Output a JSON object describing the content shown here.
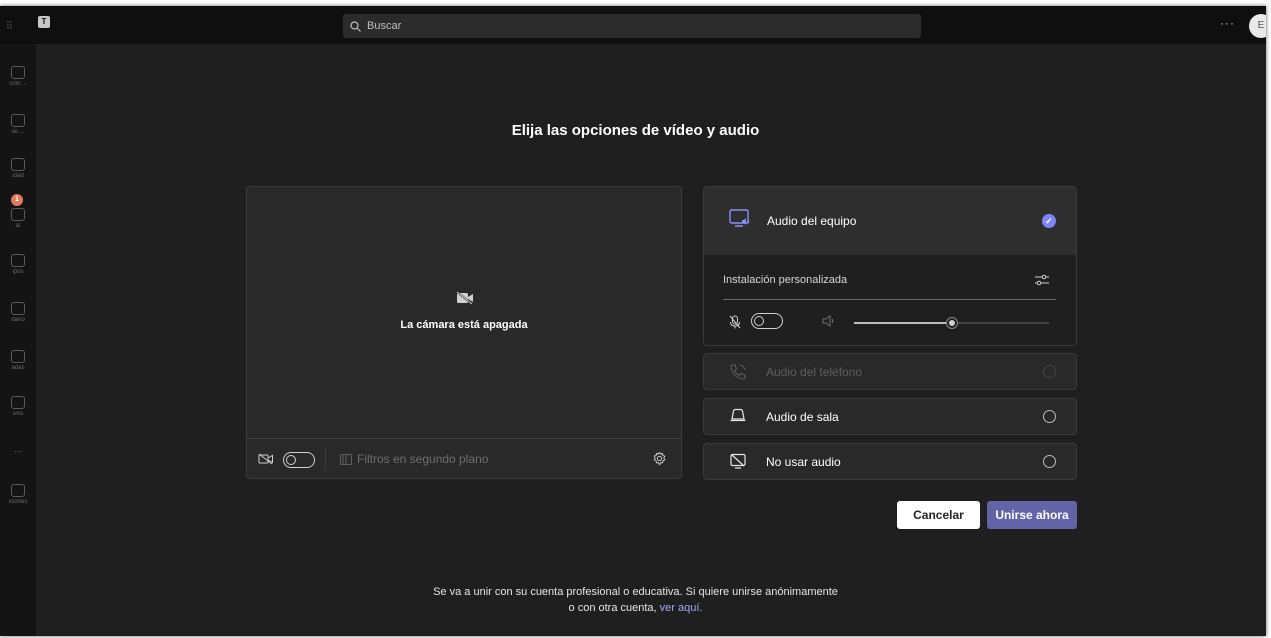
{
  "titlebar": {
    "search_placeholder": "Buscar",
    "more_label": "···",
    "avatar_initial": "E"
  },
  "rail": {
    "items": [
      {
        "label": "ción ..."
      },
      {
        "label": "se ..."
      },
      {
        "label": "idad"
      },
      {
        "label": "at"
      },
      {
        "label": "ipos"
      },
      {
        "label": "dario"
      },
      {
        "label": "adas"
      },
      {
        "label": "ivos"
      },
      {
        "label": "···"
      },
      {
        "label": "iciones"
      }
    ],
    "badge_count": "1"
  },
  "dialog": {
    "title": "Elija las opciones de vídeo y audio",
    "video": {
      "camera_off_text": "La cámara está apagada",
      "background_filters_label": "Filtros en segundo plano",
      "camera_on": false
    },
    "audio": {
      "computer_audio_label": "Audio del equipo",
      "custom_setup_label": "Instalación personalizada",
      "mic_on": false,
      "speaker_volume": 0.5,
      "phone_audio_label": "Audio del teléfono",
      "room_audio_label": "Audio de sala",
      "no_audio_label": "No usar audio",
      "selected": "computer"
    },
    "buttons": {
      "cancel": "Cancelar",
      "join": "Unirse ahora"
    },
    "footer": {
      "line1": "Se va a unir con su cuenta profesional o educativa. Si quiere unirse anónimamente",
      "line2_prefix": "o con otra cuenta, ",
      "link": "ver aquí."
    }
  },
  "colors": {
    "background": "#1f1f1f",
    "panel": "#292929",
    "accent": "#6264a7",
    "check": "#7f85f5",
    "link": "#a4a8f5"
  }
}
